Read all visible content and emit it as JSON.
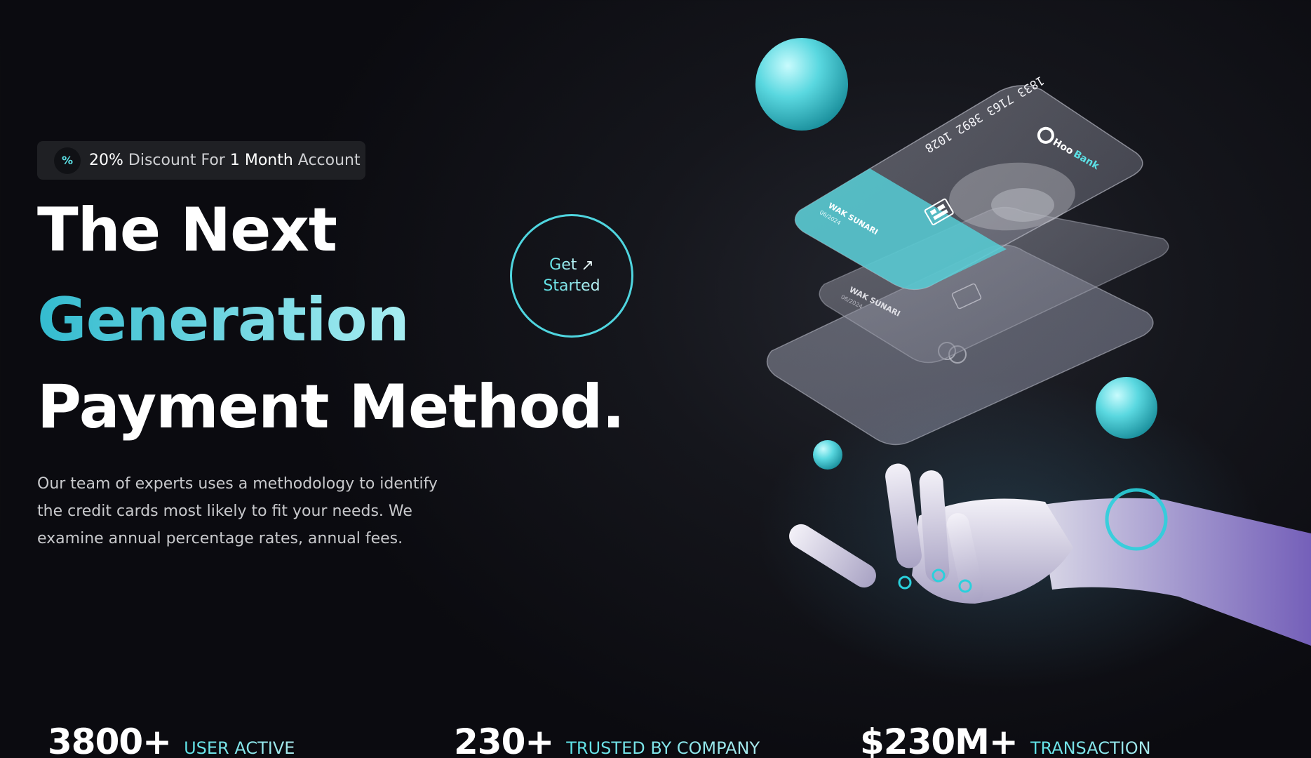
{
  "badge": {
    "icon": "percent-icon",
    "percent": "20%",
    "text1": " Discount For ",
    "duration": "1 Month",
    "text2": " Account"
  },
  "hero": {
    "line1": "The Next",
    "line2": "Generation",
    "line3": "Payment Method.",
    "description": "Our team of experts uses a methodology to identify the credit cards most likely to fit your needs. We examine annual percentage rates, annual fees."
  },
  "cta": {
    "line1": "Get",
    "line2": "Started",
    "icon": "arrow-up-right-icon"
  },
  "card": {
    "number": "1833 7163 3892 1028",
    "brand_hoo": "Hoo",
    "brand_bank": "Bank",
    "holder": "WAK SUNARI",
    "expiry": "06/2024"
  },
  "stats": [
    {
      "value": "3800+",
      "label": "USER ACTIVE"
    },
    {
      "value": "230+",
      "label": "TRUSTED BY COMPANY"
    },
    {
      "value": "$230M+",
      "label": "TRANSACTION"
    }
  ],
  "colors": {
    "accent": "#5ce1e6",
    "background": "#0b0b10",
    "badge_bg": "#1f2024"
  }
}
